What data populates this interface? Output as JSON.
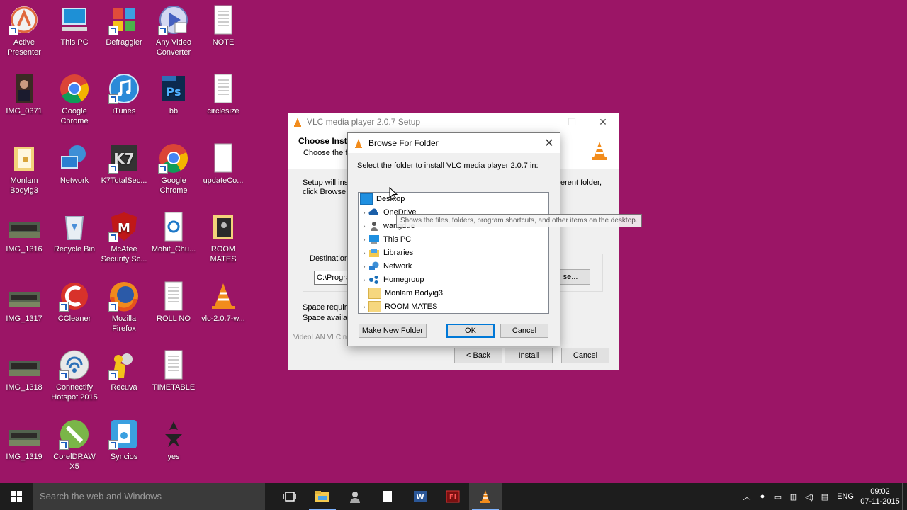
{
  "desktop": {
    "icons": [
      {
        "label": "Active Presenter"
      },
      {
        "label": "This PC"
      },
      {
        "label": "Defraggler"
      },
      {
        "label": "Any Video Converter"
      },
      {
        "label": "NOTE"
      },
      {
        "label": "IMG_0371"
      },
      {
        "label": "Google Chrome"
      },
      {
        "label": "iTunes"
      },
      {
        "label": "bb"
      },
      {
        "label": "circlesize"
      },
      {
        "label": "Monlam Bodyig3"
      },
      {
        "label": "Network"
      },
      {
        "label": "K7TotalSec..."
      },
      {
        "label": "Google Chrome"
      },
      {
        "label": "updateCo..."
      },
      {
        "label": "IMG_1316"
      },
      {
        "label": "Recycle Bin"
      },
      {
        "label": "McAfee Security Sc..."
      },
      {
        "label": "Mohit_Chu..."
      },
      {
        "label": "ROOM MATES"
      },
      {
        "label": "IMG_1317"
      },
      {
        "label": "CCleaner"
      },
      {
        "label": "Mozilla Firefox"
      },
      {
        "label": "ROLL NO"
      },
      {
        "label": "vlc-2.0.7-w..."
      },
      {
        "label": "IMG_1318"
      },
      {
        "label": "Connectify Hotspot 2015"
      },
      {
        "label": "Recuva"
      },
      {
        "label": "TIMETABLE"
      },
      {
        "label": "IMG_1319"
      },
      {
        "label": "CorelDRAW X5"
      },
      {
        "label": "Syncios"
      },
      {
        "label": "yes"
      }
    ]
  },
  "setup_window": {
    "title": "VLC media player 2.0.7 Setup",
    "controls": {
      "minimize": "—",
      "maximize": "☐",
      "close": "✕"
    },
    "heading": "Choose Insta",
    "subheading": "Choose the fo",
    "body_line1": "Setup will insta",
    "body_line1_right": "erent folder,",
    "body_line2": "click Browse a",
    "destination_label": "Destination",
    "destination_value": "C:\\Progra",
    "browse_label": "se...",
    "space_required": "Space require",
    "space_available": "Space availab",
    "footer_brand": "VideoLAN VLC me",
    "back_label": "< Back",
    "install_label": "Install",
    "cancel_label": "Cancel"
  },
  "browse_dialog": {
    "title": "Browse For Folder",
    "close": "✕",
    "instruction": "Select the folder to install VLC media player 2.0.7 in:",
    "tree": [
      {
        "label": "Desktop",
        "icon": "desktop-icon",
        "expander": false,
        "selected": true
      },
      {
        "label": "OneDrive",
        "icon": "onedrive-icon",
        "expander": true
      },
      {
        "label": "wangdue",
        "icon": "user-icon",
        "expander": true
      },
      {
        "label": "This PC",
        "icon": "computer-icon",
        "expander": true
      },
      {
        "label": "Libraries",
        "icon": "libraries-icon",
        "expander": true
      },
      {
        "label": "Network",
        "icon": "network-icon",
        "expander": true
      },
      {
        "label": "Homegroup",
        "icon": "homegroup-icon",
        "expander": true
      },
      {
        "label": "Monlam Bodyig3",
        "icon": "folder-icon",
        "expander": false
      },
      {
        "label": "ROOM MATES",
        "icon": "folder-icon",
        "expander": true
      }
    ],
    "tooltip": "Shows the files, folders, program shortcuts, and other items on the desktop.",
    "new_folder_label": "Make New Folder",
    "ok_label": "OK",
    "cancel_label": "Cancel"
  },
  "taskbar": {
    "search_placeholder": "Search the web and Windows",
    "apps": [
      "task-view-icon",
      "file-explorer-icon",
      "user-icon",
      "document-icon",
      "word-icon",
      "flash-icon",
      "vlc-icon"
    ],
    "language": "ENG",
    "time": "09:02",
    "date": "07-11-2015"
  },
  "colors": {
    "desktop_bg": "#9b1566",
    "taskbar_bg": "#1d1d1d",
    "accent": "#0078d7"
  }
}
